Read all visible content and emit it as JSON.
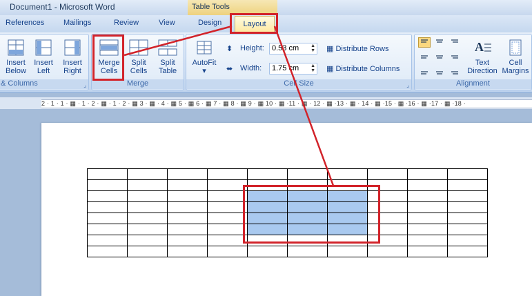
{
  "window": {
    "title": "Document1 - Microsoft Word",
    "context_tab_group": "Table Tools"
  },
  "tabs": [
    {
      "label": "References"
    },
    {
      "label": "Mailings"
    },
    {
      "label": "Review"
    },
    {
      "label": "View"
    },
    {
      "label": "Design"
    },
    {
      "label": "Layout",
      "active": true
    }
  ],
  "ribbon": {
    "rows_columns_group": {
      "label": "& Columns",
      "buttons": [
        {
          "label": "Insert Below"
        },
        {
          "label": "Insert Left"
        },
        {
          "label": "Insert Right"
        }
      ]
    },
    "merge_group": {
      "label": "Merge",
      "buttons": [
        {
          "label": "Merge Cells",
          "highlighted": true
        },
        {
          "label": "Split Cells"
        },
        {
          "label": "Split Table"
        }
      ]
    },
    "cell_size_group": {
      "label": "Cell Size",
      "autofit_label": "AutoFit",
      "height_label": "Height:",
      "height_value": "0.53 cm",
      "width_label": "Width:",
      "width_value": "1.75 cm",
      "distribute_rows": "Distribute Rows",
      "distribute_columns": "Distribute Columns"
    },
    "alignment_group": {
      "label": "Alignment",
      "text_direction": "Text Direction",
      "cell_margins": "Cell Margins"
    }
  },
  "ruler": {
    "text": "2 · 1 · 1 · ▦ · 1 · 2 · ▦ · 1 · 2 · ▦ 3 · ▦ · 4 · ▦ 5 · ▦ 6 · ▦ 7 · ▦ 8 · ▦ 9 · ▦ 10 · ▦ ·11 · ▦ · 12 · ▦ ·13 · ▦ · 14 · ▦ ·15 · ▦ ·16 · ▦ ·17 · ▦ ·18 ·"
  },
  "document": {
    "table": {
      "rows": 8,
      "columns": 10,
      "selected_rows": [
        2,
        3,
        4,
        5
      ],
      "selected_columns": [
        4,
        5,
        6
      ]
    }
  },
  "colors": {
    "highlight_red": "#d2232a",
    "selection_blue": "#a9c9ef",
    "ribbon_blue": "#dbe7f6"
  }
}
